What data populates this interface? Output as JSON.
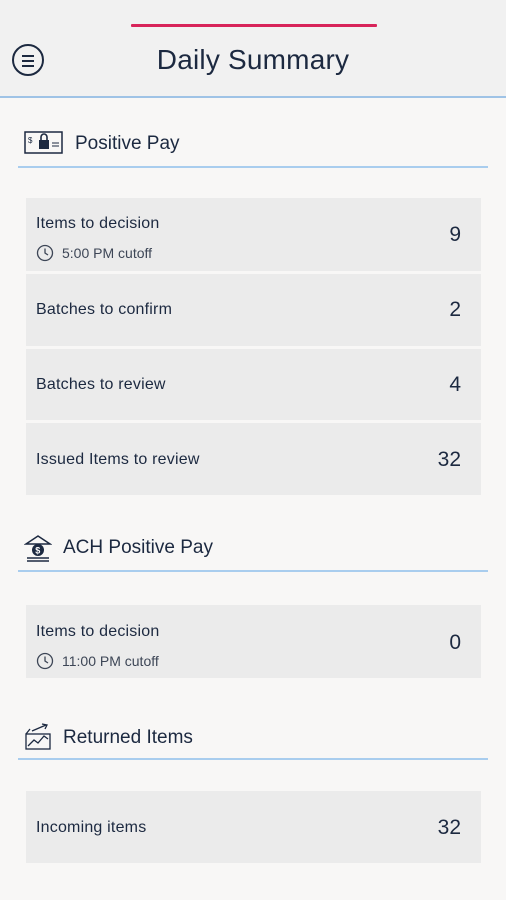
{
  "header": {
    "title": "Daily Summary",
    "menu_icon": "hamburger-menu-icon",
    "accent_color": "#d8245a"
  },
  "positive_pay": {
    "title": "Positive Pay",
    "icon": "check-lock-icon",
    "items": [
      {
        "label": "Items to decision",
        "sub": "5:00 PM cutoff",
        "count": "9"
      },
      {
        "label": "Batches to confirm",
        "count": "2"
      },
      {
        "label": "Batches to review",
        "count": "4"
      },
      {
        "label": "Issued Items to review",
        "count": "32"
      }
    ]
  },
  "ach_positive_pay": {
    "title": "ACH Positive Pay",
    "icon": "bank-dollar-icon",
    "items": [
      {
        "label": "Items to decision",
        "sub": "11:00 PM cutoff",
        "count": "0"
      }
    ]
  },
  "returned_items": {
    "title": "Returned Items",
    "icon": "returned-items-icon",
    "items": [
      {
        "label": "Incoming items",
        "count": "32"
      }
    ]
  },
  "colors": {
    "text": "#1c2940",
    "card_bg": "#ebebeb",
    "divider_blue": "#a9cdee"
  }
}
